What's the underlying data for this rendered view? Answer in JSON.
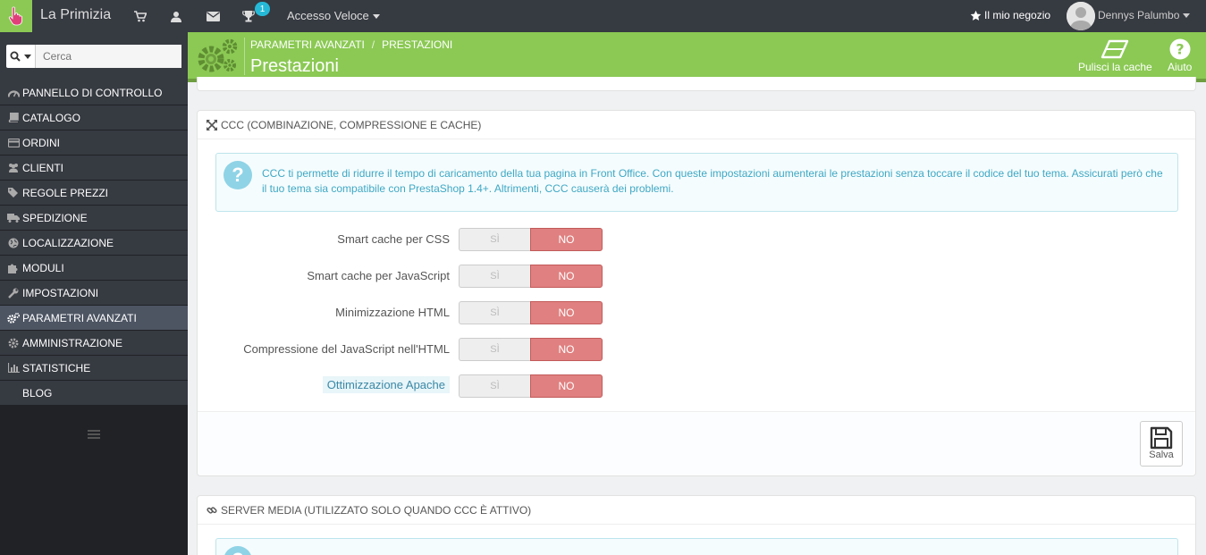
{
  "topbar": {
    "shop_name": "La Primizia",
    "notification_count": "1",
    "quick_access": "Accesso Veloce",
    "my_shop": "Il mio negozio",
    "username": "Dennys Palumbo"
  },
  "search": {
    "placeholder": "Cerca"
  },
  "sidebar": {
    "items": [
      {
        "label": "PANNELLO DI CONTROLLO",
        "icon": "dashboard-icon"
      },
      {
        "label": "CATALOGO",
        "icon": "book-icon"
      },
      {
        "label": "ORDINI",
        "icon": "credit-card-icon"
      },
      {
        "label": "CLIENTI",
        "icon": "users-icon"
      },
      {
        "label": "REGOLE PREZZI",
        "icon": "tags-icon"
      },
      {
        "label": "SPEDIZIONE",
        "icon": "truck-icon"
      },
      {
        "label": "LOCALIZZAZIONE",
        "icon": "globe-icon"
      },
      {
        "label": "MODULI",
        "icon": "puzzle-icon"
      },
      {
        "label": "IMPOSTAZIONI",
        "icon": "wrench-icon"
      },
      {
        "label": "PARAMETRI AVANZATI",
        "icon": "gears-icon",
        "active": true
      },
      {
        "label": "AMMINISTRAZIONE",
        "icon": "cog-icon"
      },
      {
        "label": "STATISTICHE",
        "icon": "bar-chart-icon"
      },
      {
        "label": "BLOG",
        "icon": ""
      }
    ]
  },
  "header": {
    "breadcrumb": [
      "PARAMETRI AVANZATI",
      "PRESTAZIONI"
    ],
    "title": "Prestazioni",
    "clear_cache": "Pulisci la cache",
    "help": "Aiuto"
  },
  "ccc_panel": {
    "title": "CCC (COMBINAZIONE, COMPRESSIONE E CACHE)",
    "info": "CCC ti permette di ridurre il tempo di caricamento della tua pagina in Front Office. Con queste impostazioni aumenterai le prestazioni senza toccare il codice del tuo tema. Assicurati però che il tuo tema sia compatibile con PrestaShop 1.4+. Altrimenti, CCC causerà dei problemi.",
    "options": [
      {
        "label": "Smart cache per CSS",
        "yes": "SÌ",
        "no": "NO"
      },
      {
        "label": "Smart cache per JavaScript",
        "yes": "SÌ",
        "no": "NO"
      },
      {
        "label": "Minimizzazione HTML",
        "yes": "SÌ",
        "no": "NO"
      },
      {
        "label": "Compressione del JavaScript nell'HTML",
        "yes": "SÌ",
        "no": "NO"
      },
      {
        "label": "Ottimizzazione Apache",
        "yes": "SÌ",
        "no": "NO"
      }
    ],
    "save_label": "Salva"
  },
  "media_panel": {
    "title": "SERVER MEDIA (UTILIZZATO SOLO QUANDO CCC È ATTIVO)"
  },
  "colors": {
    "accent_green": "#8bc954",
    "no_red": "#e08080",
    "info_blue": "#3ea8c5",
    "badge_blue": "#25b9d7"
  }
}
